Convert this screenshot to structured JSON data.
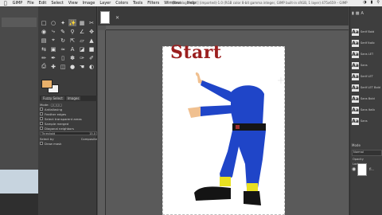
{
  "menubar": {
    "apple_icon": "apple-icon",
    "items": [
      "GIMP",
      "File",
      "Edit",
      "Select",
      "View",
      "Image",
      "Layer",
      "Colors",
      "Tools",
      "Filters",
      "Windows",
      "Help"
    ],
    "window_title": "*[final-logo-start] (imported)-1.0 (RGB color 8-bit gamma integer, GIMP built-in sRGB, 1 layer) 475x659 – GIMP"
  },
  "toolbox": {
    "options_tabs": [
      "Fuzzy Select",
      "Images"
    ],
    "mode_label": "Mode:",
    "options": [
      {
        "label": "Antialiasing",
        "checked": true
      },
      {
        "label": "Feather edges",
        "checked": false
      },
      {
        "label": "Select transparent areas",
        "checked": true
      },
      {
        "label": "Sample merged",
        "checked": false
      },
      {
        "label": "Diagonal neighbors",
        "checked": false
      }
    ],
    "threshold_label": "Threshold",
    "threshold_value": "15.0",
    "select_by_label": "Select by",
    "select_by_value": "Composite",
    "draw_mask_label": "Draw mask",
    "colors": {
      "foreground": "#e8b06a",
      "background": "#f2f2f2"
    }
  },
  "canvas": {
    "start_text": "Start",
    "start_color": "#9b1f1f"
  },
  "dock": {
    "fonts": [
      "Serif Bold",
      "Serif Italic",
      "Sans LET",
      "Sans",
      "Serif LET",
      "Serif LET Bold",
      "Sans Bold",
      "Sans Italic",
      "Sans"
    ],
    "layers_mode_label": "Mode",
    "layers_mode_value": "Normal",
    "opacity_label": "Opacity",
    "lock_label": "Lock",
    "layer_name": "fi..."
  }
}
